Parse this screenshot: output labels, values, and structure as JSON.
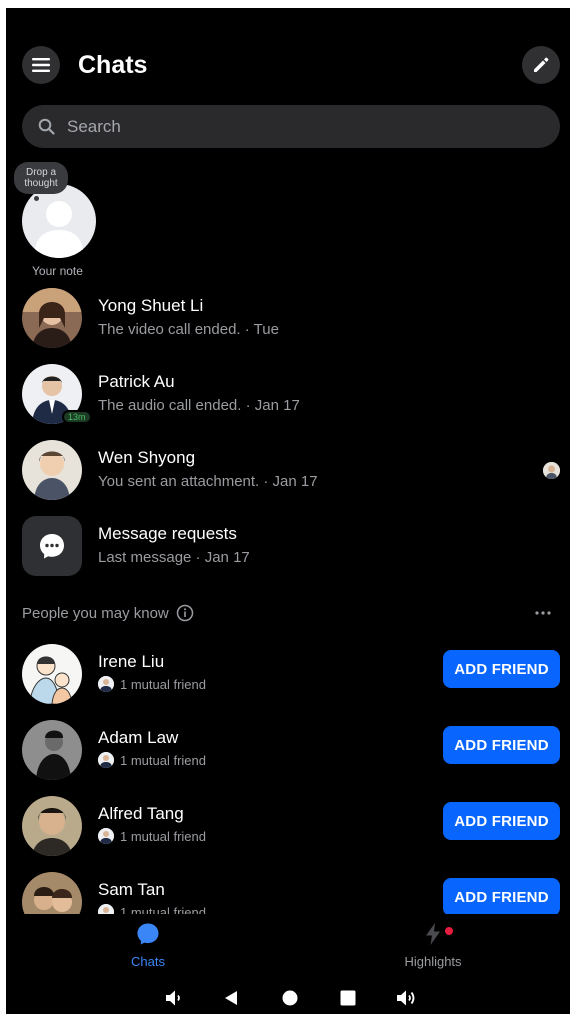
{
  "header": {
    "title": "Chats"
  },
  "search": {
    "placeholder": "Search"
  },
  "note": {
    "bubble_text": "Drop a thought",
    "label": "Your note"
  },
  "chats": [
    {
      "name": "Yong Shuet Li",
      "preview": "The video call ended. · Tue"
    },
    {
      "name": "Patrick Au",
      "preview": "The audio call ended. · Jan 17",
      "active_badge": "13m"
    },
    {
      "name": "Wen Shyong",
      "preview": "You sent an attachment. · Jan 17"
    },
    {
      "name": "Message requests",
      "preview": "Last message · Jan 17"
    }
  ],
  "people_you_may_know": {
    "title": "People you may know",
    "people": [
      {
        "name": "Irene Liu",
        "mutual": "1 mutual friend",
        "button": "ADD FRIEND"
      },
      {
        "name": "Adam Law",
        "mutual": "1 mutual friend",
        "button": "ADD FRIEND"
      },
      {
        "name": "Alfred Tang",
        "mutual": "1 mutual friend",
        "button": "ADD FRIEND"
      },
      {
        "name": "Sam Tan",
        "mutual": "1 mutual friend",
        "button": "ADD FRIEND"
      }
    ]
  },
  "tabs": [
    {
      "label": "Chats",
      "active": true
    },
    {
      "label": "Highlights",
      "active": false
    }
  ],
  "colors": {
    "accent": "#0866ff",
    "tab_active": "#3b86f7",
    "notification": "#e41e3f",
    "online": "#45bd62"
  },
  "icons": [
    "menu-icon",
    "pencil-icon",
    "search-icon",
    "chat-bubble-icon",
    "info-icon",
    "more-icon",
    "lightning-icon",
    "volume-down-icon",
    "back-icon",
    "home-icon",
    "recents-icon",
    "volume-up-icon"
  ]
}
